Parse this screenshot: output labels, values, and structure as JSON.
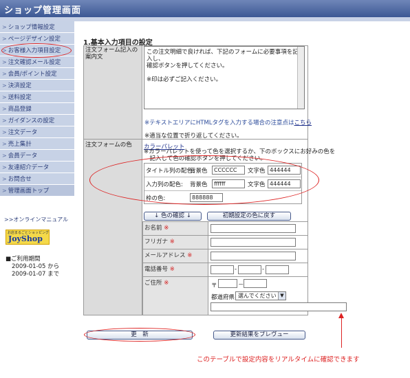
{
  "header": {
    "title": "ショップ管理画面"
  },
  "sidebar": {
    "items": [
      {
        "label": "ショップ情報設定"
      },
      {
        "label": "ページデザイン設定"
      },
      {
        "label": "お客様入力項目設定"
      },
      {
        "label": "注文確認メール設定"
      },
      {
        "label": "会員/ポイント設定"
      },
      {
        "label": "決済設定"
      },
      {
        "label": "送料設定"
      },
      {
        "label": "商品登録"
      },
      {
        "label": "ガイダンスの設定"
      },
      {
        "label": "注文データ"
      },
      {
        "label": "売上集計"
      },
      {
        "label": "会員データ"
      },
      {
        "label": "友達紹介データ"
      },
      {
        "label": "お問合せ"
      },
      {
        "label": "管理画面トップ"
      }
    ],
    "online_manual": ">>オンラインマニュアル",
    "logo_small": "お店まるごとショッピング",
    "logo_big": "JoyShop",
    "period_label": "■ご利用期間",
    "period_from": "2009-01-05  から",
    "period_to": "2009-01-07  まで"
  },
  "form": {
    "section_title": "1.基本入力項目の設定",
    "guide_label": "注文フォーム記入の案内文",
    "guide_text": "この注文明細で良ければ、下記のフォームに必要事項を記入し、\n確認ボタンを押してください。\n\n※印は必ずご記入ください。",
    "html_note_prefix": "※テキストエリアにHTMLタグを入力する場合の注意点は",
    "html_note_link": "こちら",
    "wrap_note": "※適当な位置で折り返してください。",
    "color_label": "注文フォームの色",
    "palette_link": "カラーパレット",
    "palette_desc": "※カラーパレットを使って色を選択するか、下のボックスにお好みの色を\n　記入して色の確認ボタンを押してください。",
    "title_row_label": "タイトル列の配色:",
    "input_row_label": "入力列の配色:",
    "frame_label": "枠の色:",
    "bg_label": "背景色",
    "text_label": "文字色",
    "title_bg": "CCCCCC",
    "title_fg": "444444",
    "input_bg": "ffffff",
    "input_fg": "444444",
    "frame_color": "888888",
    "confirm_color_button": "↓ 色の確認 ↓",
    "reset_color_button": "初期設定の色に戻す",
    "preview": {
      "name_label": "お名前",
      "kana_label": "フリガナ",
      "email_label": "メールアドレス",
      "phone_label": "電話番号",
      "address_label": "ご住所",
      "required_mark": "※",
      "postal_mark": "〒",
      "prefecture_label": "都道府県",
      "prefecture_select": "選んでください",
      "dash": "-",
      "zip_dash": "－"
    },
    "update_button": "更　新",
    "preview_button": "更新結果をプレヴュー"
  },
  "annotation": "このテーブルで設定内容をリアルタイムに確認できます",
  "colors": {
    "accent": "#3c5894",
    "annotation": "#dd2222"
  }
}
